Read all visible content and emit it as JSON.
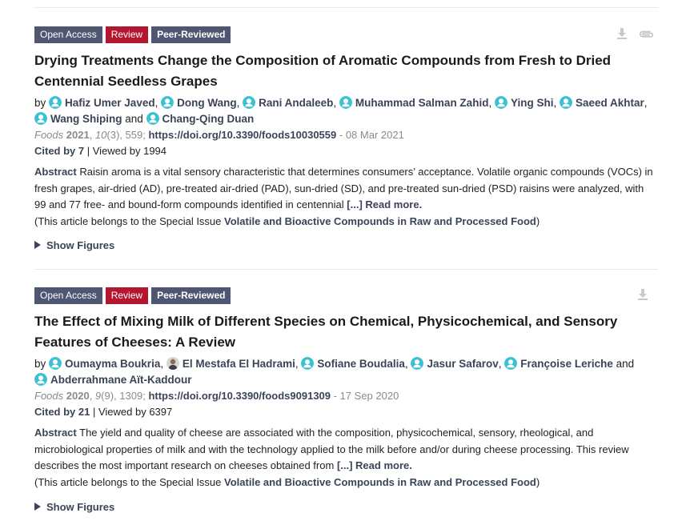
{
  "articles": [
    {
      "badges": {
        "open_access": "Open Access",
        "review": "Review",
        "peer_reviewed": "Peer-Reviewed"
      },
      "title": "Drying Treatments Change the Composition of Aromatic Compounds from Fresh to Dried Centennial Seedless Grapes",
      "by": "by",
      "authors": [
        "Hafiz Umer Javed",
        "Dong Wang",
        "Rani Andaleeb",
        "Muhammad Salman Zahid",
        "Ying Shi",
        "Saeed Akhtar",
        "Wang Shiping",
        "Chang-Qing Duan"
      ],
      "and": "and",
      "journal": "Foods",
      "year": "2021",
      "volume": "10",
      "issue_pages": "(3), 559;",
      "doi": "https://doi.org/10.3390/foods10030559",
      "date": "- 08 Mar 2021",
      "cited": "Cited by 7",
      "viewed": "| Viewed by 1994",
      "abstract_label": "Abstract",
      "abstract": "Raisin aroma is a vital sensory characteristic that determines consumers’ acceptance. Volatile organic compounds (VOCs) in fresh grapes, air-dried (AD), pre-treated air-dried (PAD), sun-dried (SD), and pre-treated sun-dried (PSD) raisins were analyzed, with 99 and 77 free- and bound-form compounds identified in centennial",
      "read_more": "[...] Read more.",
      "special_prefix": "(This article belongs to the Special Issue",
      "special_issue": "Volatile and Bioactive Compounds in Raw and Processed Food",
      "special_suffix": ")",
      "show_figures": "Show Figures",
      "icons": [
        "download-icon",
        "attachment-icon"
      ]
    },
    {
      "badges": {
        "open_access": "Open Access",
        "review": "Review",
        "peer_reviewed": "Peer-Reviewed"
      },
      "title": "The Effect of Mixing Milk of Different Species on Chemical, Physicochemical, and Sensory Features of Cheeses: A Review",
      "by": "by",
      "authors": [
        "Oumayma Boukria",
        "El Mestafa El Hadrami",
        "Sofiane Boudalia",
        "Jasur Safarov",
        "Françoise Leriche",
        "Abderrahmane Aït-Kaddour"
      ],
      "and": "and",
      "journal": "Foods",
      "year": "2020",
      "volume": "9",
      "issue_pages": "(9), 1309;",
      "doi": "https://doi.org/10.3390/foods9091309",
      "date": "- 17 Sep 2020",
      "cited": "Cited by 21",
      "viewed": "| Viewed by 6397",
      "abstract_label": "Abstract",
      "abstract": "The yield and quality of cheese are associated with the composition, physicochemical, sensory, rheological, and microbiological properties of milk and with the technology applied to the milk before and/or during cheese processing. This review describes the most important research on cheeses obtained from",
      "read_more": "[...] Read more.",
      "special_prefix": "(This article belongs to the Special Issue",
      "special_issue": "Volatile and Bioactive Compounds in Raw and Processed Food",
      "special_suffix": ")",
      "show_figures": "Show Figures",
      "icons": [
        "download-icon"
      ]
    }
  ],
  "colors": {
    "badge_gray": "#4f5671",
    "badge_red": "#b5162f",
    "avatar_teal": "#3cc1d3",
    "link_dark": "#3b4457"
  }
}
